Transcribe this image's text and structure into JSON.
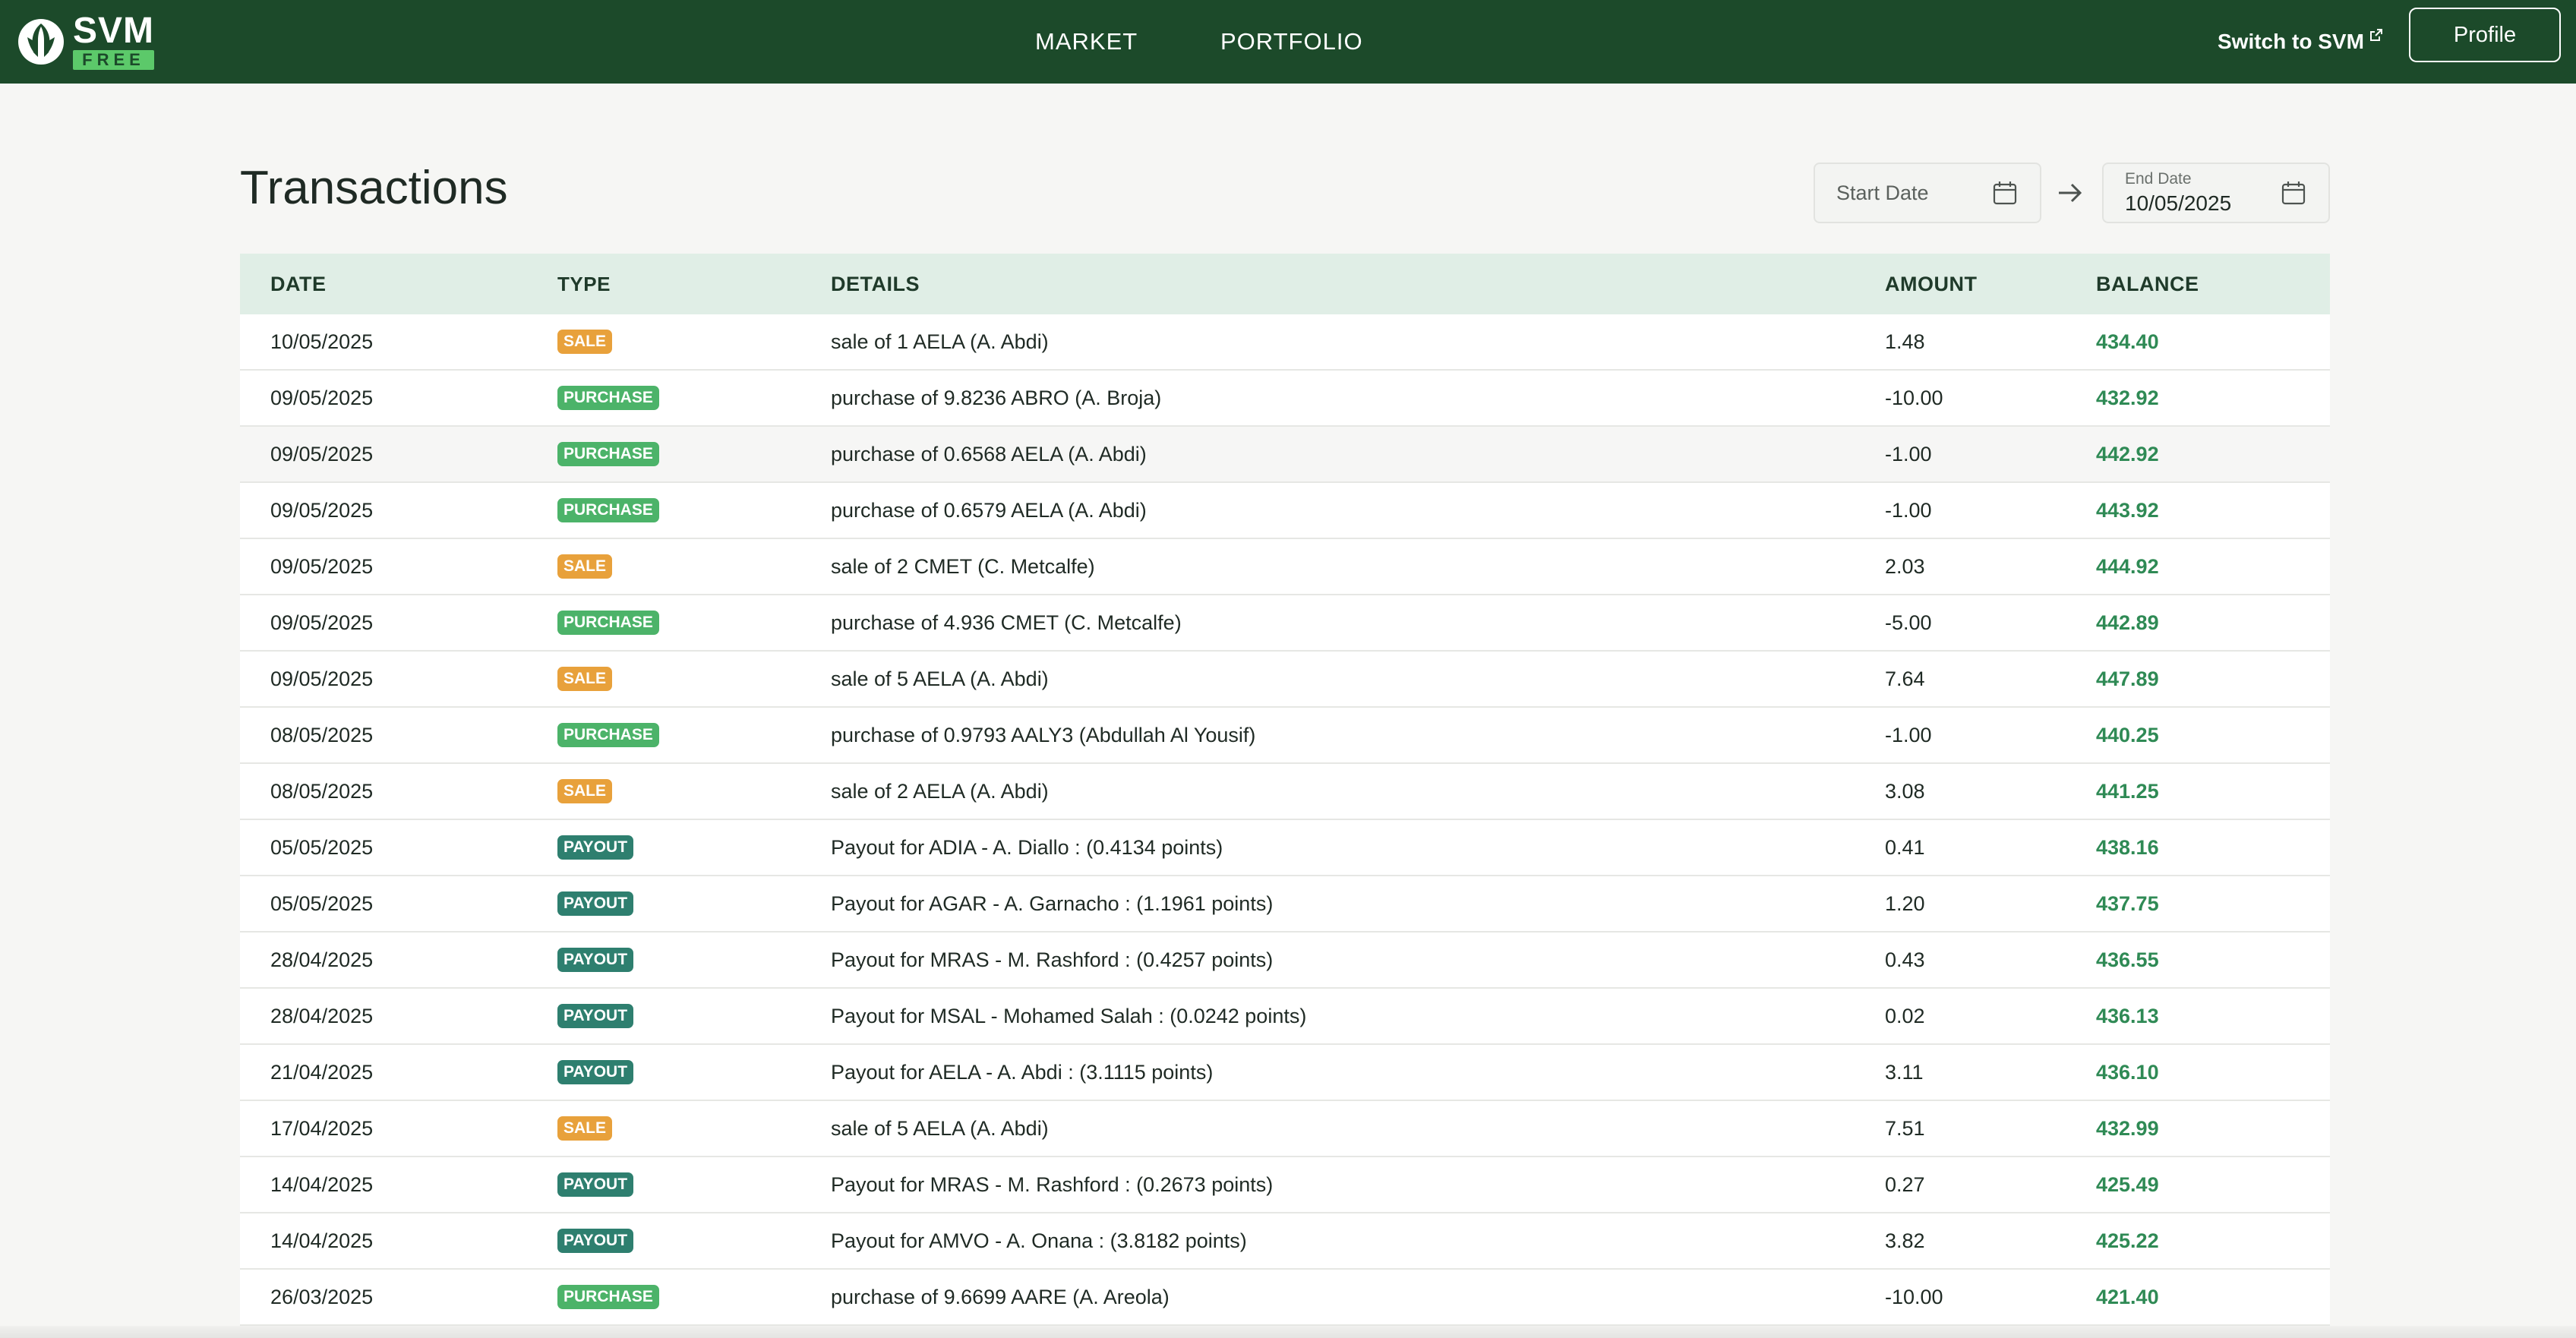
{
  "header": {
    "logo": {
      "title": "SVM",
      "badge": "FREE"
    },
    "nav": [
      {
        "label": "MARKET"
      },
      {
        "label": "PORTFOLIO"
      }
    ],
    "switch_label": "Switch to SVM",
    "profile_label": "Profile",
    "colors": {
      "bar": "#1c4a2a",
      "badge": "#5cc96a"
    }
  },
  "page": {
    "title": "Transactions",
    "filters": {
      "start_placeholder": "Start Date",
      "end_label": "End Date",
      "end_value": "10/05/2025"
    }
  },
  "table": {
    "columns": [
      "DATE",
      "TYPE",
      "DETAILS",
      "AMOUNT",
      "BALANCE"
    ],
    "rows": [
      {
        "date": "10/05/2025",
        "type": "SALE",
        "details": "sale of 1 AELA (A. Abdi)",
        "amount": "1.48",
        "balance": "434.40"
      },
      {
        "date": "09/05/2025",
        "type": "PURCHASE",
        "details": "purchase of 9.8236 ABRO (A. Broja)",
        "amount": "-10.00",
        "balance": "432.92"
      },
      {
        "date": "09/05/2025",
        "type": "PURCHASE",
        "details": "purchase of 0.6568 AELA (A. Abdi)",
        "amount": "-1.00",
        "balance": "442.92"
      },
      {
        "date": "09/05/2025",
        "type": "PURCHASE",
        "details": "purchase of 0.6579 AELA (A. Abdi)",
        "amount": "-1.00",
        "balance": "443.92"
      },
      {
        "date": "09/05/2025",
        "type": "SALE",
        "details": "sale of 2 CMET (C. Metcalfe)",
        "amount": "2.03",
        "balance": "444.92"
      },
      {
        "date": "09/05/2025",
        "type": "PURCHASE",
        "details": "purchase of 4.936 CMET (C. Metcalfe)",
        "amount": "-5.00",
        "balance": "442.89"
      },
      {
        "date": "09/05/2025",
        "type": "SALE",
        "details": "sale of 5 AELA (A. Abdi)",
        "amount": "7.64",
        "balance": "447.89"
      },
      {
        "date": "08/05/2025",
        "type": "PURCHASE",
        "details": "purchase of 0.9793 AALY3 (Abdullah Al Yousif)",
        "amount": "-1.00",
        "balance": "440.25"
      },
      {
        "date": "08/05/2025",
        "type": "SALE",
        "details": "sale of 2 AELA (A. Abdi)",
        "amount": "3.08",
        "balance": "441.25"
      },
      {
        "date": "05/05/2025",
        "type": "PAYOUT",
        "details": "Payout for ADIA - A. Diallo : (0.4134 points)",
        "amount": "0.41",
        "balance": "438.16"
      },
      {
        "date": "05/05/2025",
        "type": "PAYOUT",
        "details": "Payout for AGAR - A. Garnacho : (1.1961 points)",
        "amount": "1.20",
        "balance": "437.75"
      },
      {
        "date": "28/04/2025",
        "type": "PAYOUT",
        "details": "Payout for MRAS - M. Rashford : (0.4257 points)",
        "amount": "0.43",
        "balance": "436.55"
      },
      {
        "date": "28/04/2025",
        "type": "PAYOUT",
        "details": "Payout for MSAL - Mohamed Salah : (0.0242 points)",
        "amount": "0.02",
        "balance": "436.13"
      },
      {
        "date": "21/04/2025",
        "type": "PAYOUT",
        "details": "Payout for AELA - A. Abdi : (3.1115 points)",
        "amount": "3.11",
        "balance": "436.10"
      },
      {
        "date": "17/04/2025",
        "type": "SALE",
        "details": "sale of 5 AELA (A. Abdi)",
        "amount": "7.51",
        "balance": "432.99"
      },
      {
        "date": "14/04/2025",
        "type": "PAYOUT",
        "details": "Payout for MRAS - M. Rashford : (0.2673 points)",
        "amount": "0.27",
        "balance": "425.49"
      },
      {
        "date": "14/04/2025",
        "type": "PAYOUT",
        "details": "Payout for AMVO - A. Onana : (3.8182 points)",
        "amount": "3.82",
        "balance": "425.22"
      },
      {
        "date": "26/03/2025",
        "type": "PURCHASE",
        "details": "purchase of 9.6699 AARE (A. Areola)",
        "amount": "-10.00",
        "balance": "421.40"
      }
    ],
    "badge_colors": {
      "SALE": "#e8a13b",
      "PURCHASE": "#4cb369",
      "PAYOUT": "#2e7f6f"
    },
    "balance_color": "#2f8a55"
  }
}
